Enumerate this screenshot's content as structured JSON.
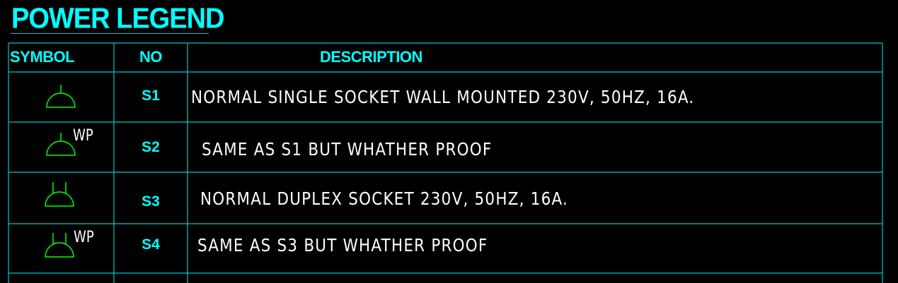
{
  "title": "POWER LEGEND",
  "headers": {
    "symbol": "SYMBOL",
    "no": "NO",
    "description": "DESCRIPTION"
  },
  "rows": [
    {
      "symbol_icon": "single-socket-icon",
      "symbol_tag": "",
      "no": "S1",
      "description": "NORMAL SINGLE SOCKET WALL MOUNTED 230V, 50HZ, 16A."
    },
    {
      "symbol_icon": "single-socket-icon",
      "symbol_tag": "WP",
      "no": "S2",
      "description": "SAME AS S1 BUT WHATHER PROOF"
    },
    {
      "symbol_icon": "duplex-socket-icon",
      "symbol_tag": "",
      "no": "S3",
      "description": "NORMAL DUPLEX SOCKET 230V, 50HZ, 16A."
    },
    {
      "symbol_icon": "duplex-socket-icon",
      "symbol_tag": "WP",
      "no": "S4",
      "description": "SAME AS S3 BUT WHATHER PROOF"
    }
  ],
  "colors": {
    "background": "#000000",
    "heading_text": "#00ffff",
    "grid_lines": "#00c8c8",
    "symbol_stroke": "#00ff00",
    "description_text": "#ffffff"
  }
}
